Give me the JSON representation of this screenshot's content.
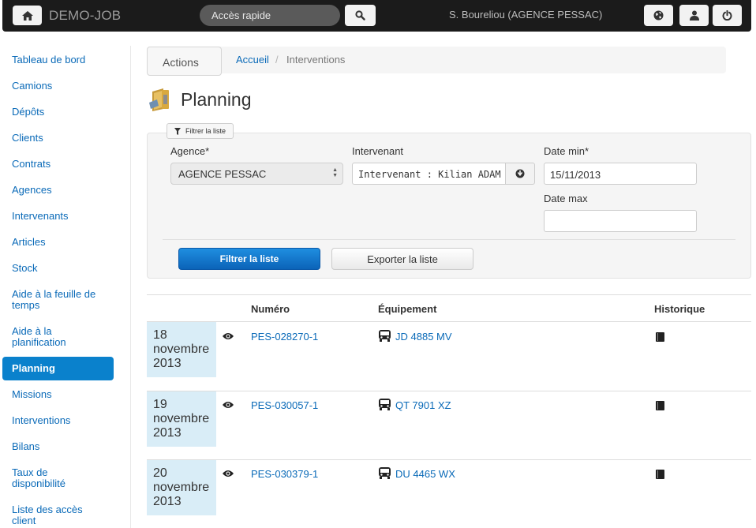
{
  "topbar": {
    "brand": "DEMO-JOB",
    "quick_access": "Accès rapide",
    "user": "S. Boureliou (AGENCE PESSAC)"
  },
  "sidebar": {
    "items": [
      {
        "label": "Tableau de bord"
      },
      {
        "label": "Camions"
      },
      {
        "label": "Dépôts"
      },
      {
        "label": "Clients"
      },
      {
        "label": "Contrats"
      },
      {
        "label": "Agences"
      },
      {
        "label": "Intervenants"
      },
      {
        "label": "Articles"
      },
      {
        "label": "Stock"
      },
      {
        "label": "Aide à la feuille de temps"
      },
      {
        "label": "Aide à la planification"
      },
      {
        "label": "Planning",
        "active": true
      },
      {
        "label": "Missions"
      },
      {
        "label": "Interventions"
      },
      {
        "label": "Bilans"
      },
      {
        "label": "Taux de disponibilité"
      },
      {
        "label": "Liste des accès client"
      }
    ]
  },
  "breadcrumb": {
    "actions_label": "Actions",
    "home": "Accueil",
    "separator": "/",
    "current": "Interventions"
  },
  "page": {
    "title": "Planning"
  },
  "filter": {
    "toggle_label": "Filtrer la liste",
    "agence_label": "Agence*",
    "agence_value": "AGENCE PESSAC",
    "intervenant_label": "Intervenant",
    "intervenant_value": "Intervenant : Kilian ADAM",
    "date_min_label": "Date min*",
    "date_min_value": "15/11/2013",
    "date_max_label": "Date max",
    "date_max_value": "",
    "submit_label": "Filtrer la liste",
    "export_label": "Exporter la liste"
  },
  "table": {
    "headers": {
      "numero": "Numéro",
      "equipement": "Équipement",
      "historique": "Historique"
    },
    "rows": [
      {
        "day": "18",
        "month": "novembre",
        "year": "2013",
        "numero": "PES-028270-1",
        "equipement": "JD 4885 MV"
      },
      {
        "day": "19",
        "month": "novembre",
        "year": "2013",
        "numero": "PES-030057-1",
        "equipement": "QT 7901 XZ"
      },
      {
        "day": "20",
        "month": "novembre",
        "year": "2013",
        "numero": "PES-030379-1",
        "equipement": "DU 4465 WX"
      }
    ]
  },
  "icons": {
    "home": "home-icon",
    "search": "search-icon",
    "globe": "globe-icon",
    "user": "user-icon",
    "power": "power-icon",
    "funnel": "funnel-icon",
    "download": "download-circle-icon",
    "eye": "eye-icon",
    "bus": "bus-icon",
    "book": "book-icon",
    "planning": "folder-planning-icon"
  },
  "colors": {
    "link": "#0a6ab8",
    "active_nav": "#0a81cc",
    "date_cell": "#d9edf7",
    "topbar": "#1b1b1b"
  }
}
